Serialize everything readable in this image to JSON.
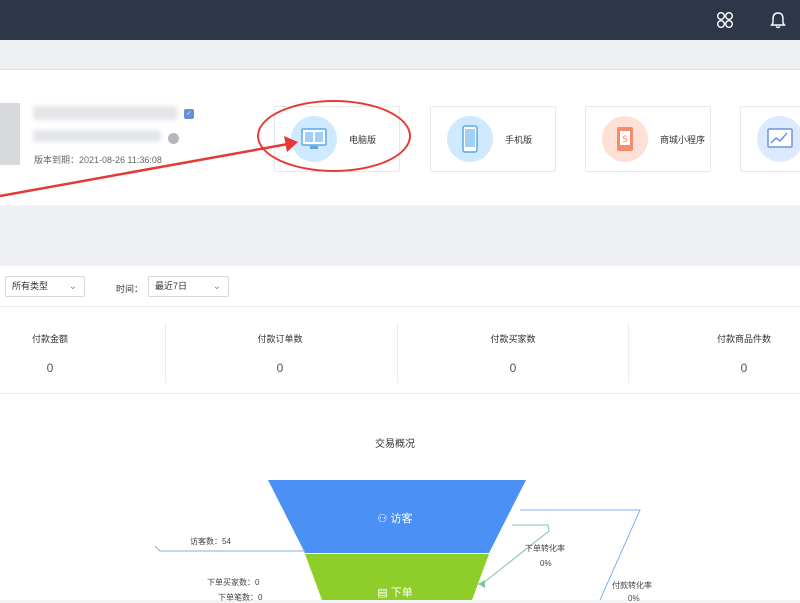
{
  "header": {
    "icons": [
      "apps-icon",
      "bell-icon"
    ]
  },
  "account": {
    "expire_text": "版本到期：2021-08-26 11:36:08"
  },
  "versions": [
    {
      "label": "电脑版",
      "icon": "desktop-icon",
      "color": "#cfeaff"
    },
    {
      "label": "手机版",
      "icon": "mobile-icon",
      "color": "#cfeaff"
    },
    {
      "label": "商城小程序",
      "icon": "mini-program-icon",
      "color": "#ffe0d6"
    },
    {
      "label": "",
      "icon": "chart-icon",
      "color": "#dde9ff"
    }
  ],
  "filters": {
    "type_value": "所有类型",
    "time_label": "时间：",
    "time_value": "最近7日"
  },
  "stats": [
    {
      "title": "付款金额",
      "value": "0"
    },
    {
      "title": "付款订单数",
      "value": "0"
    },
    {
      "title": "付款买家数",
      "value": "0"
    },
    {
      "title": "付款商品件数",
      "value": "0"
    }
  ],
  "funnel": {
    "title": "交易概况",
    "stages": [
      {
        "label": "访客",
        "color": "#4a90f5",
        "icon": "users-icon"
      },
      {
        "label": "下单",
        "color": "#8fcd2a",
        "icon": "order-icon"
      }
    ],
    "visitors": "访客数：54",
    "order_buyers": "下单买家数：0",
    "order_count": "下单笔数：0",
    "order_rate_label": "下单转化率",
    "order_rate_value": "0%",
    "pay_rate_label": "付款转化率",
    "pay_rate_value": "0%"
  }
}
